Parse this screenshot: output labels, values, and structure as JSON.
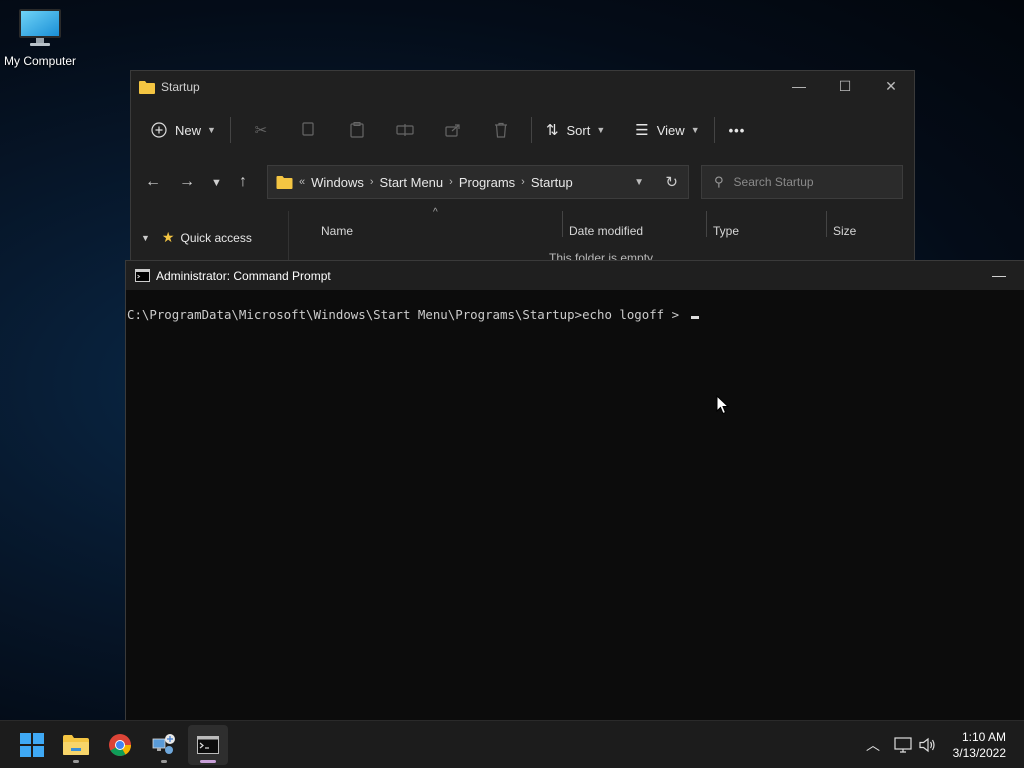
{
  "desktop": {
    "icons": [
      {
        "label": "My Computer",
        "icon": "monitor-icon"
      }
    ]
  },
  "explorer": {
    "title": "Startup",
    "toolbar": {
      "new_label": "New",
      "sort_label": "Sort",
      "view_label": "View",
      "more_label": "•••"
    },
    "breadcrumb": [
      "Windows",
      "Start Menu",
      "Programs",
      "Startup"
    ],
    "breadcrumb_overflow": "«",
    "search_placeholder": "Search Startup",
    "nav": {
      "quick_access": "Quick access"
    },
    "columns": [
      "Name",
      "Date modified",
      "Type",
      "Size"
    ],
    "empty_text": "This folder is empty."
  },
  "cmd": {
    "title": "Administrator: Command Prompt",
    "prompt": "C:\\ProgramData\\Microsoft\\Windows\\Start Menu\\Programs\\Startup>",
    "command": "echo logoff > "
  },
  "taskbar": {
    "apps": [
      "start-icon",
      "file-explorer-icon",
      "chrome-icon",
      "network-admin-icon",
      "command-prompt-icon"
    ],
    "clock_time": "1:10 AM",
    "clock_date": "3/13/2022"
  },
  "colors": {
    "folder": "#f4c542",
    "accent": "#c8a0d8",
    "cmd_bg": "#0c0c0c",
    "explorer_bg": "#202020"
  }
}
